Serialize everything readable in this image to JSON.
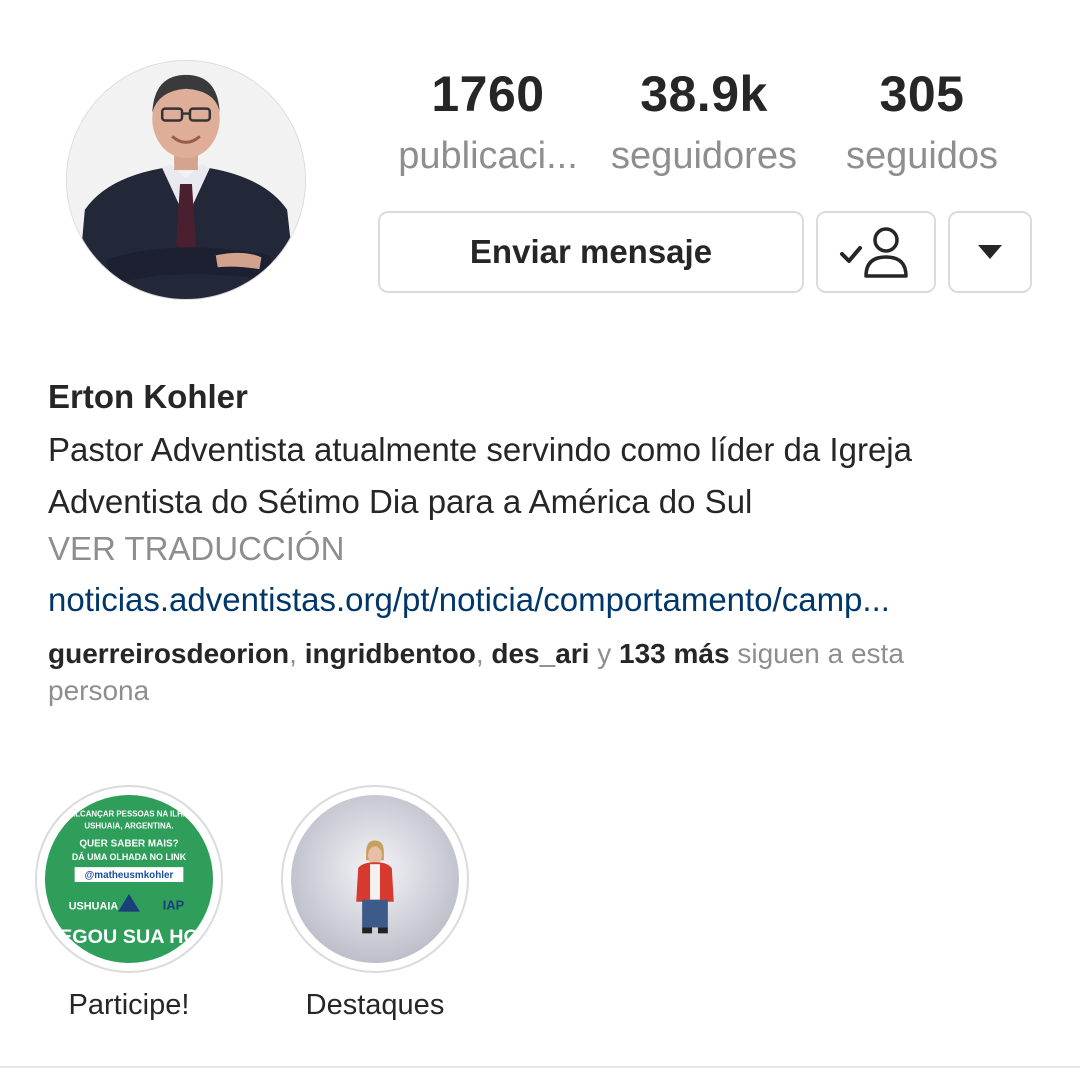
{
  "profile": {
    "avatar_icon": "profile-photo",
    "name": "Erton Kohler",
    "bio": "Pastor Adventista atualmente servindo como líder da Igreja Adventista do Sétimo Dia para a América do Sul",
    "translate_label": "VER TRADUCCIÓN",
    "link": "noticias.adventistas.org/pt/noticia/comportamento/camp..."
  },
  "stats": {
    "posts": {
      "value": "1760",
      "label": "publicaci..."
    },
    "followers": {
      "value": "38.9k",
      "label": "seguidores"
    },
    "following": {
      "value": "305",
      "label": "seguidos"
    }
  },
  "actions": {
    "message_label": "Enviar mensaje",
    "following_icon": "person-check-icon",
    "more_icon": "caret-down-icon"
  },
  "followed_by": {
    "user1": "guerreirosdeorion",
    "sep1": ", ",
    "user2": "ingridbentoo",
    "sep2": ", ",
    "user3": "des_ari",
    "conj": " y ",
    "more": "133 más",
    "suffix": " siguen a esta persona"
  },
  "highlights": [
    {
      "label": "Participe!",
      "cover_text": {
        "line1": "ALCANÇAR PESSOAS NA ILHA",
        "line2": "USHUAIA, ARGENTINA.",
        "line3": "QUER SABER MAIS?",
        "line4": "DÁ UMA OLHADA NO LINK",
        "handle": "@matheusmkohler",
        "logo1": "USHUAIA",
        "logo2": "IAP",
        "banner": "CHEGOU SUA HORA"
      }
    },
    {
      "label": "Destaques"
    }
  ],
  "colors": {
    "text": "#262626",
    "secondary": "#8e8e8e",
    "link": "#00376b",
    "border": "#dbdbdb",
    "highlight_green": "#2f9e5a"
  }
}
